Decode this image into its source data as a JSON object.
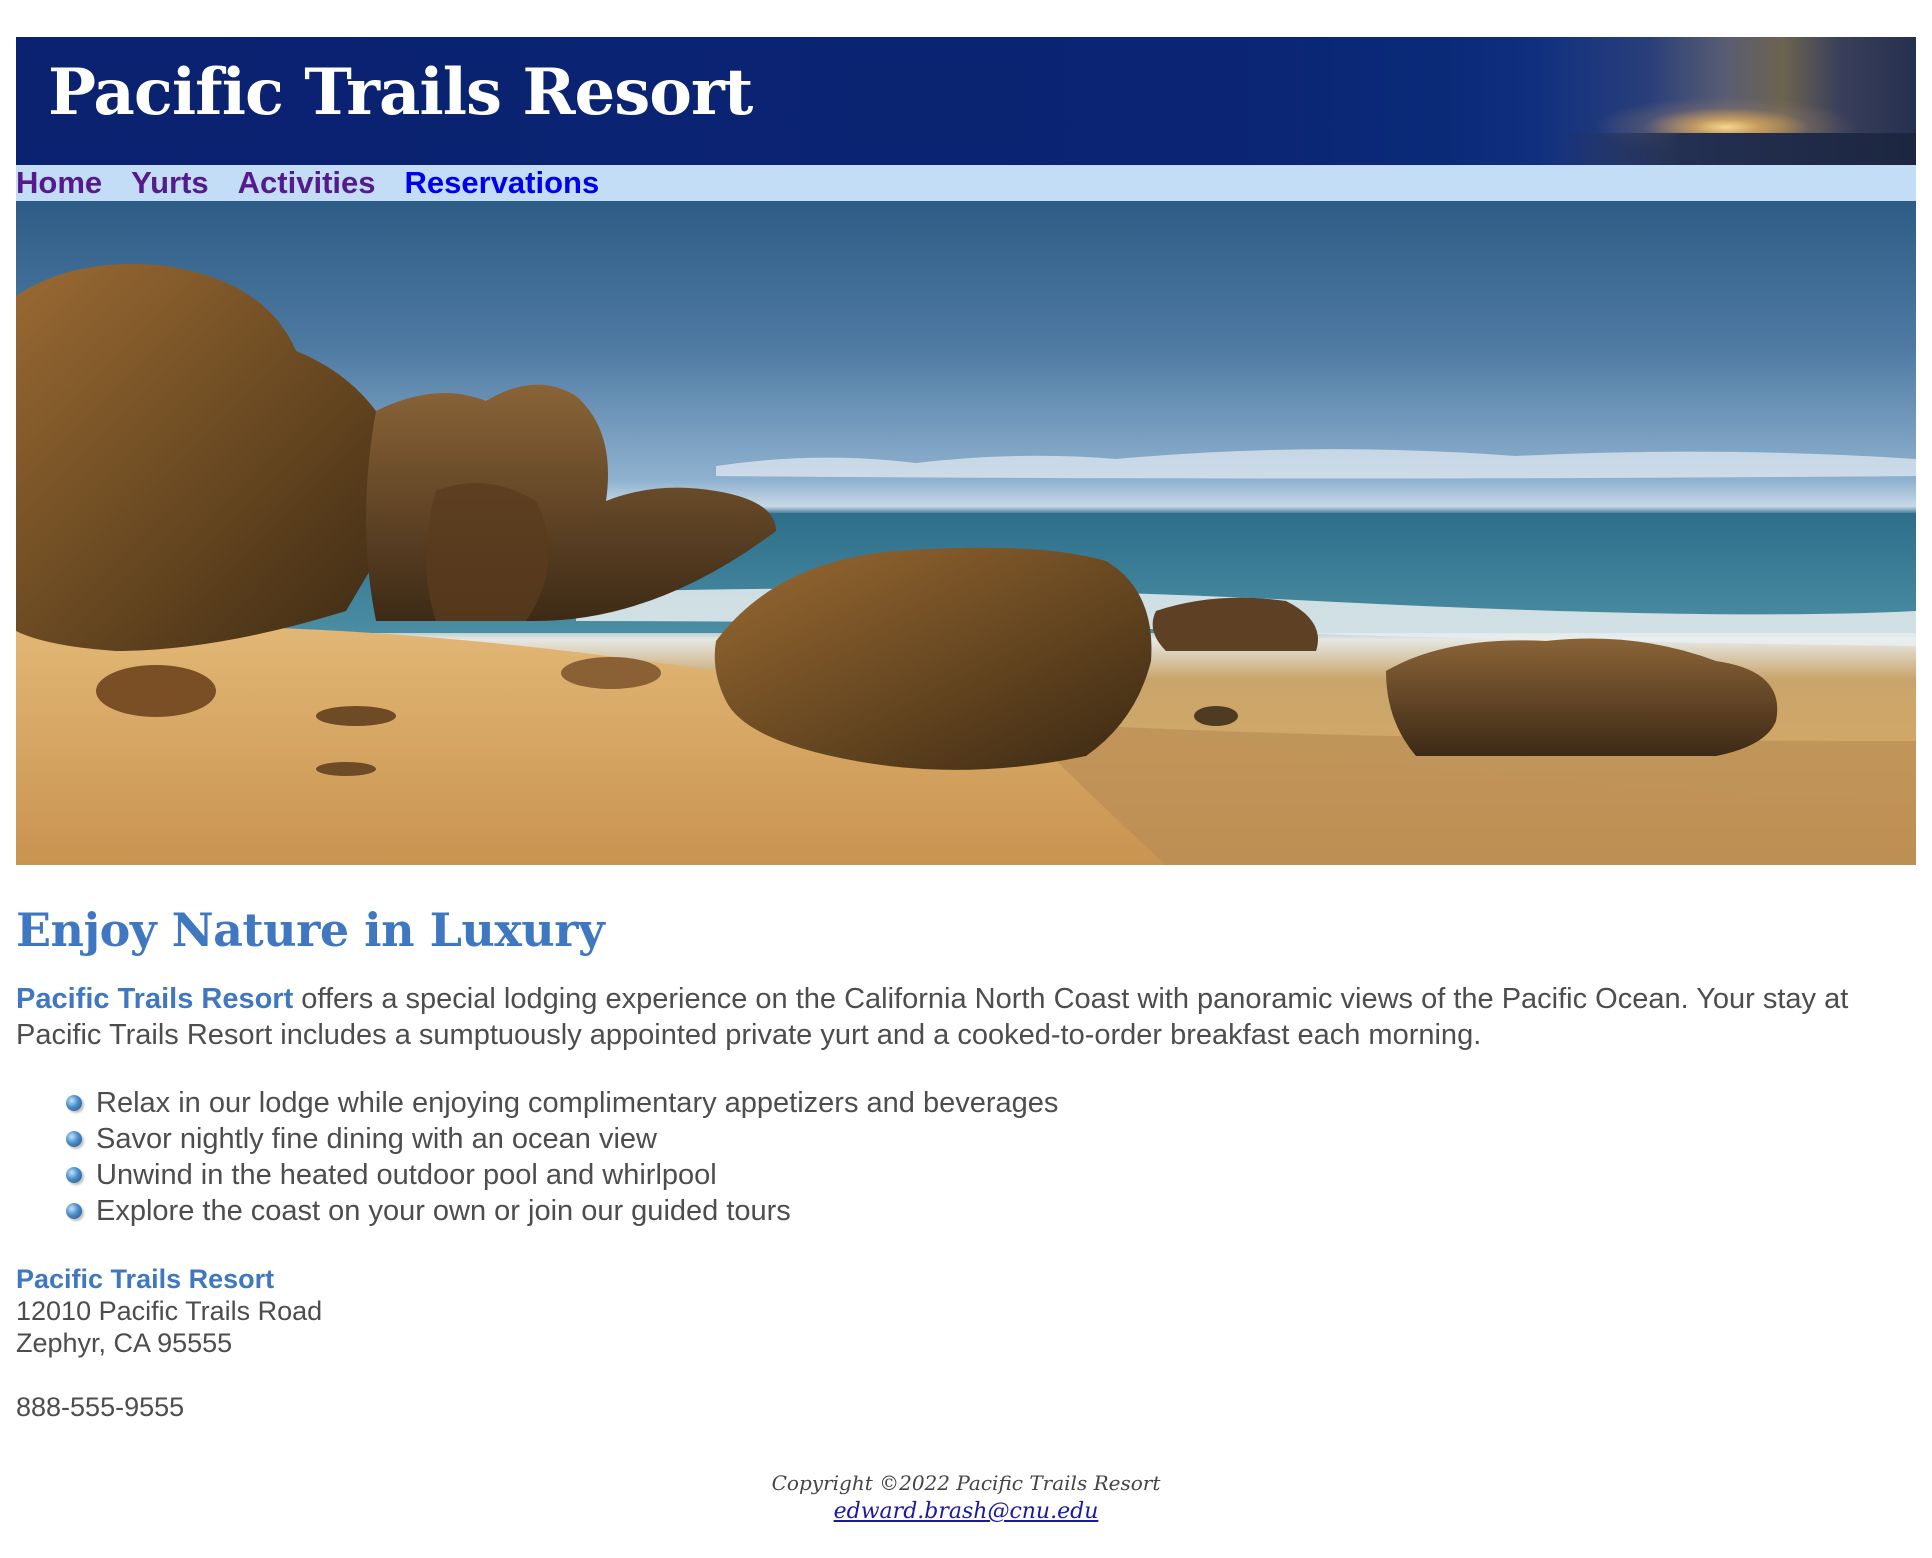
{
  "header": {
    "title": "Pacific Trails Resort"
  },
  "nav": {
    "items": [
      {
        "label": "Home",
        "state": "visited"
      },
      {
        "label": "Yurts",
        "state": "visited"
      },
      {
        "label": "Activities",
        "state": "visited"
      },
      {
        "label": "Reservations",
        "state": "link"
      }
    ]
  },
  "hero": {
    "icon": "coastal-beach-photo"
  },
  "main": {
    "heading": "Enjoy Nature in Luxury",
    "intro_brand": "Pacific Trails Resort",
    "intro_text": " offers a special lodging experience on the California North Coast with panoramic views of the Pacific Ocean. Your stay at Pacific Trails Resort includes a sumptuously appointed private yurt and a cooked-to-order breakfast each morning.",
    "amenities": [
      "Relax in our lodge while enjoying complimentary appetizers and beverages",
      "Savor nightly fine dining with an ocean view",
      "Unwind in the heated outdoor pool and whirlpool",
      "Explore the coast on your own or join our guided tours"
    ],
    "contact": {
      "name": "Pacific Trails Resort",
      "street": "12010 Pacific Trails Road",
      "city": "Zephyr, CA 95555",
      "phone": "888-555-9555"
    }
  },
  "footer": {
    "copyright": "Copyright ©2022 Pacific Trails Resort",
    "email": "edward.brash@cnu.edu"
  },
  "colors": {
    "header_bg": "#0b2473",
    "nav_bg": "#c3ddf6",
    "accent": "#3f78c1",
    "text": "#4d4d4d"
  }
}
